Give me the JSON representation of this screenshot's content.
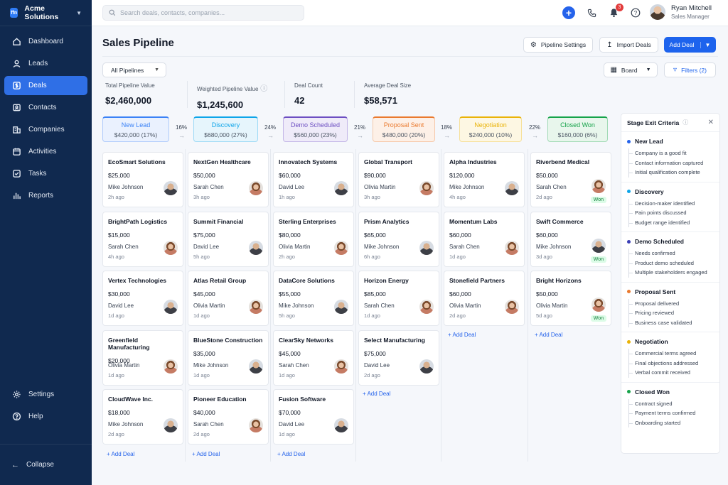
{
  "app": {
    "name": "Acme Solutions",
    "logo": "ffn"
  },
  "sidebar": {
    "items": [
      {
        "label": "Dashboard",
        "icon": "home-icon"
      },
      {
        "label": "Leads",
        "icon": "user-icon"
      },
      {
        "label": "Deals",
        "icon": "dollar-icon",
        "active": true
      },
      {
        "label": "Contacts",
        "icon": "contact-card-icon"
      },
      {
        "label": "Companies",
        "icon": "building-icon"
      },
      {
        "label": "Activities",
        "icon": "calendar-icon"
      },
      {
        "label": "Tasks",
        "icon": "checkbox-icon"
      },
      {
        "label": "Reports",
        "icon": "bar-chart-icon"
      }
    ],
    "bottom": [
      {
        "label": "Settings",
        "icon": "gear-icon"
      },
      {
        "label": "Help",
        "icon": "help-icon"
      }
    ],
    "collapse_label": "Collapse"
  },
  "topbar": {
    "search_placeholder": "Search deals, contacts, companies...",
    "notification_count": "3",
    "user_name": "Ryan Mitchell",
    "user_role": "Sales Manager"
  },
  "header": {
    "title": "Sales Pipeline",
    "pipeline_settings": "Pipeline Settings",
    "import_deals": "Import Deals",
    "add_deal": "Add Deal",
    "pipeline_select": "All Pipelines",
    "view_select": "Board",
    "filters": "Filters (2)"
  },
  "metrics": [
    {
      "label": "Total Pipeline Value",
      "value": "$2,460,000"
    },
    {
      "label": "Weighted Pipeline Value",
      "value": "$1,245,600"
    },
    {
      "label": "Deal Count",
      "value": "42"
    },
    {
      "label": "Average Deal Size",
      "value": "$58,571"
    }
  ],
  "stages": [
    {
      "name": "New Lead",
      "summary": "$420,000 (17%)",
      "color": "#3b82f6",
      "bg": "#eaf1fe"
    },
    {
      "name": "Discovery",
      "summary": "$680,000 (27%)",
      "color": "#0ea5e9",
      "bg": "#e6f5fc"
    },
    {
      "name": "Demo Scheduled",
      "summary": "$560,000 (23%)",
      "color": "#6d4fc2",
      "bg": "#efebf9"
    },
    {
      "name": "Proposal Sent",
      "summary": "$480,000 (20%)",
      "color": "#ea7a2f",
      "bg": "#fdf0e7"
    },
    {
      "name": "Negotiation",
      "summary": "$240,000 (10%)",
      "color": "#eab308",
      "bg": "#fdf7e3"
    },
    {
      "name": "Closed Won",
      "summary": "$160,000 (6%)",
      "color": "#16a34a",
      "bg": "#e8f6ec"
    }
  ],
  "conversions": [
    "16%",
    "24%",
    "21%",
    "18%",
    "22%"
  ],
  "columns": [
    [
      {
        "title": "EcoSmart Solutions",
        "amount": "$25,000",
        "owner": "Mike Johnson",
        "age": "2h ago",
        "av": "m"
      },
      {
        "title": "BrightPath Logistics",
        "amount": "$15,000",
        "owner": "Sarah Chen",
        "age": "4h ago",
        "av": "f"
      },
      {
        "title": "Vertex Technologies",
        "amount": "$30,000",
        "owner": "David Lee",
        "age": "1d ago",
        "av": "m"
      },
      {
        "title": "Greenfield Manufacturing",
        "amount": "$20,000",
        "owner": "Olivia Martin",
        "age": "1d ago",
        "av": "f"
      },
      {
        "title": "CloudWave Inc.",
        "amount": "$18,000",
        "owner": "Mike Johnson",
        "age": "2d ago",
        "av": "m"
      }
    ],
    [
      {
        "title": "NextGen Healthcare",
        "amount": "$50,000",
        "owner": "Sarah Chen",
        "age": "3h ago",
        "av": "f"
      },
      {
        "title": "Summit Financial",
        "amount": "$75,000",
        "owner": "David Lee",
        "age": "5h ago",
        "av": "m"
      },
      {
        "title": "Atlas Retail Group",
        "amount": "$45,000",
        "owner": "Olivia Martin",
        "age": "1d ago",
        "av": "f"
      },
      {
        "title": "BlueStone Construction",
        "amount": "$35,000",
        "owner": "Mike Johnson",
        "age": "1d ago",
        "av": "m"
      },
      {
        "title": "Pioneer Education",
        "amount": "$40,000",
        "owner": "Sarah Chen",
        "age": "2d ago",
        "av": "f"
      }
    ],
    [
      {
        "title": "Innovatech Systems",
        "amount": "$60,000",
        "owner": "David Lee",
        "age": "1h ago",
        "av": "m"
      },
      {
        "title": "Sterling Enterprises",
        "amount": "$80,000",
        "owner": "Olivia Martin",
        "age": "2h ago",
        "av": "f"
      },
      {
        "title": "DataCore Solutions",
        "amount": "$55,000",
        "owner": "Mike Johnson",
        "age": "5h ago",
        "av": "m"
      },
      {
        "title": "ClearSky Networks",
        "amount": "$45,000",
        "owner": "Sarah Chen",
        "age": "1d ago",
        "av": "f"
      },
      {
        "title": "Fusion Software",
        "amount": "$70,000",
        "owner": "David Lee",
        "age": "1d ago",
        "av": "m"
      }
    ],
    [
      {
        "title": "Global Transport",
        "amount": "$90,000",
        "owner": "Olivia Martin",
        "age": "3h ago",
        "av": "f"
      },
      {
        "title": "Prism Analytics",
        "amount": "$65,000",
        "owner": "Mike Johnson",
        "age": "6h ago",
        "av": "m"
      },
      {
        "title": "Horizon Energy",
        "amount": "$85,000",
        "owner": "Sarah Chen",
        "age": "1d ago",
        "av": "f"
      },
      {
        "title": "Select Manufacturing",
        "amount": "$75,000",
        "owner": "David Lee",
        "age": "2d ago",
        "av": "m"
      }
    ],
    [
      {
        "title": "Alpha Industries",
        "amount": "$120,000",
        "owner": "Mike Johnson",
        "age": "4h ago",
        "av": "m"
      },
      {
        "title": "Momentum Labs",
        "amount": "$60,000",
        "owner": "Sarah Chen",
        "age": "1d ago",
        "av": "f"
      },
      {
        "title": "Stonefield Partners",
        "amount": "$60,000",
        "owner": "Olivia Martin",
        "age": "2d ago",
        "av": "f"
      }
    ],
    [
      {
        "title": "Riverbend Medical",
        "amount": "$50,000",
        "owner": "Sarah Chen",
        "age": "2d ago",
        "av": "f",
        "won": "Won"
      },
      {
        "title": "Swift Commerce",
        "amount": "$60,000",
        "owner": "Mike Johnson",
        "age": "3d ago",
        "av": "m",
        "won": "Won"
      },
      {
        "title": "Bright Horizons",
        "amount": "$50,000",
        "owner": "Olivia Martin",
        "age": "5d ago",
        "av": "f",
        "won": "Won"
      }
    ]
  ],
  "add_deal_label": "+ Add Deal",
  "criteria": {
    "title": "Stage Exit Criteria",
    "stages": [
      {
        "name": "New Lead",
        "color": "#2563eb",
        "items": [
          "Company is a good fit",
          "Contact information captured",
          "Initial qualification complete"
        ]
      },
      {
        "name": "Discovery",
        "color": "#0ea5e9",
        "items": [
          "Decision-maker identified",
          "Pain points discussed",
          "Budget range identified"
        ]
      },
      {
        "name": "Demo Scheduled",
        "color": "#3b3fb6",
        "items": [
          "Needs confirmed",
          "Product demo scheduled",
          "Multiple stakeholders engaged"
        ]
      },
      {
        "name": "Proposal Sent",
        "color": "#ea7a2f",
        "items": [
          "Proposal delivered",
          "Pricing reviewed",
          "Business case validated"
        ]
      },
      {
        "name": "Negotiation",
        "color": "#eab308",
        "items": [
          "Commercial terms agreed",
          "Final objections addressed",
          "Verbal commit received"
        ]
      },
      {
        "name": "Closed Won",
        "color": "#16a34a",
        "items": [
          "Contract signed",
          "Payment terms confirmed",
          "Onboarding started"
        ]
      }
    ]
  }
}
